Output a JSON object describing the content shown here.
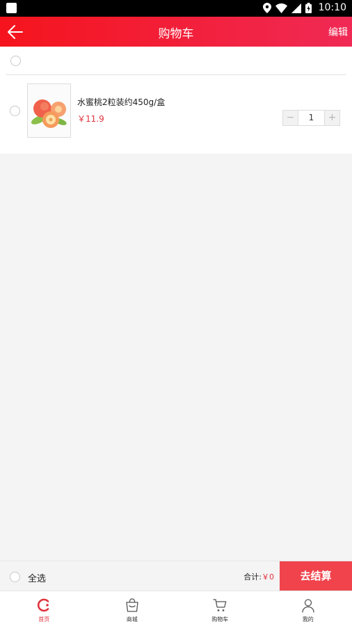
{
  "status_bar": {
    "time": "10:10"
  },
  "header": {
    "title": "购物车",
    "edit_label": "编辑"
  },
  "cart": {
    "items": [
      {
        "name": "水蜜桃2粒装约450g/盒",
        "price": "￥11.9",
        "quantity": "1"
      }
    ]
  },
  "stepper": {
    "minus": "−",
    "plus": "+"
  },
  "checkout": {
    "select_all_label": "全选",
    "total_label": "合计:",
    "total_amount": "￥0",
    "button_label": "去结算"
  },
  "tabbar": {
    "tabs": [
      {
        "label": "首页",
        "icon": "home-icon",
        "active": true
      },
      {
        "label": "商城",
        "icon": "shop-bag-icon",
        "active": false
      },
      {
        "label": "购物车",
        "icon": "cart-icon",
        "active": false
      },
      {
        "label": "我的",
        "icon": "user-icon",
        "active": false
      }
    ]
  },
  "colors": {
    "accent": "#f5141d",
    "price": "#e0333d",
    "checkout": "#f0434c"
  }
}
